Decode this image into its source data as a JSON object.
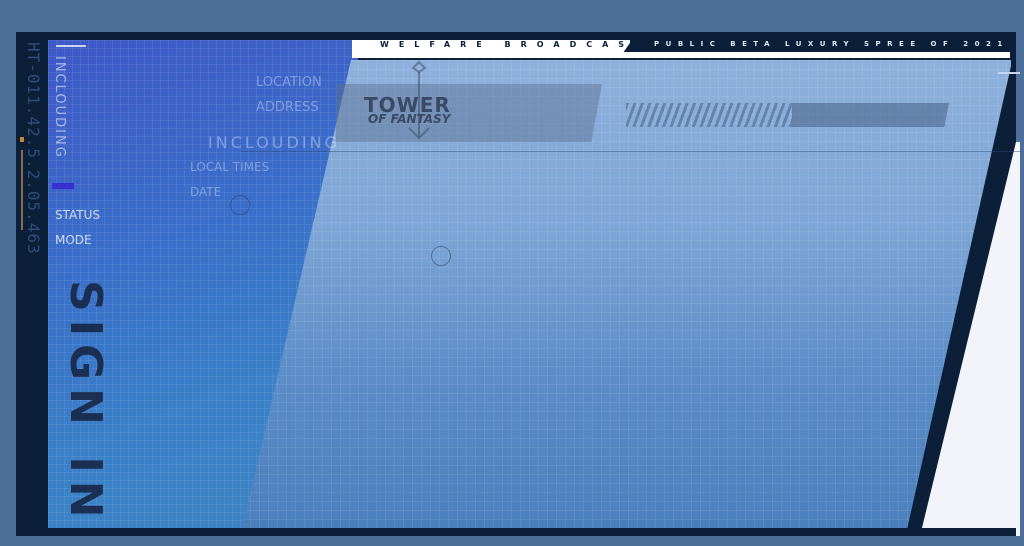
{
  "header": {
    "welfare_broadcast": "WELFARE BROADCAST",
    "public_beta": "PUBLIC BETA LUXURY SPREE OF 2021"
  },
  "logo": {
    "line1": "TOWER",
    "line2": "OF FANTASY"
  },
  "side": {
    "code": "HT-011.42.5.2.05.463",
    "including": "INCLOUDING",
    "sign_in": "SIGN IN"
  },
  "labels": {
    "location": "LOCATION",
    "address": "ADDRESS",
    "including": "INCLOUDING",
    "local_times": "LOCAL TIMES",
    "date": "DATE",
    "status": "STATUS",
    "mode": "MODE"
  },
  "colors": {
    "frame": "#0b1f38",
    "accent": "#3a2fd0",
    "panel": "#7ea6d6"
  }
}
